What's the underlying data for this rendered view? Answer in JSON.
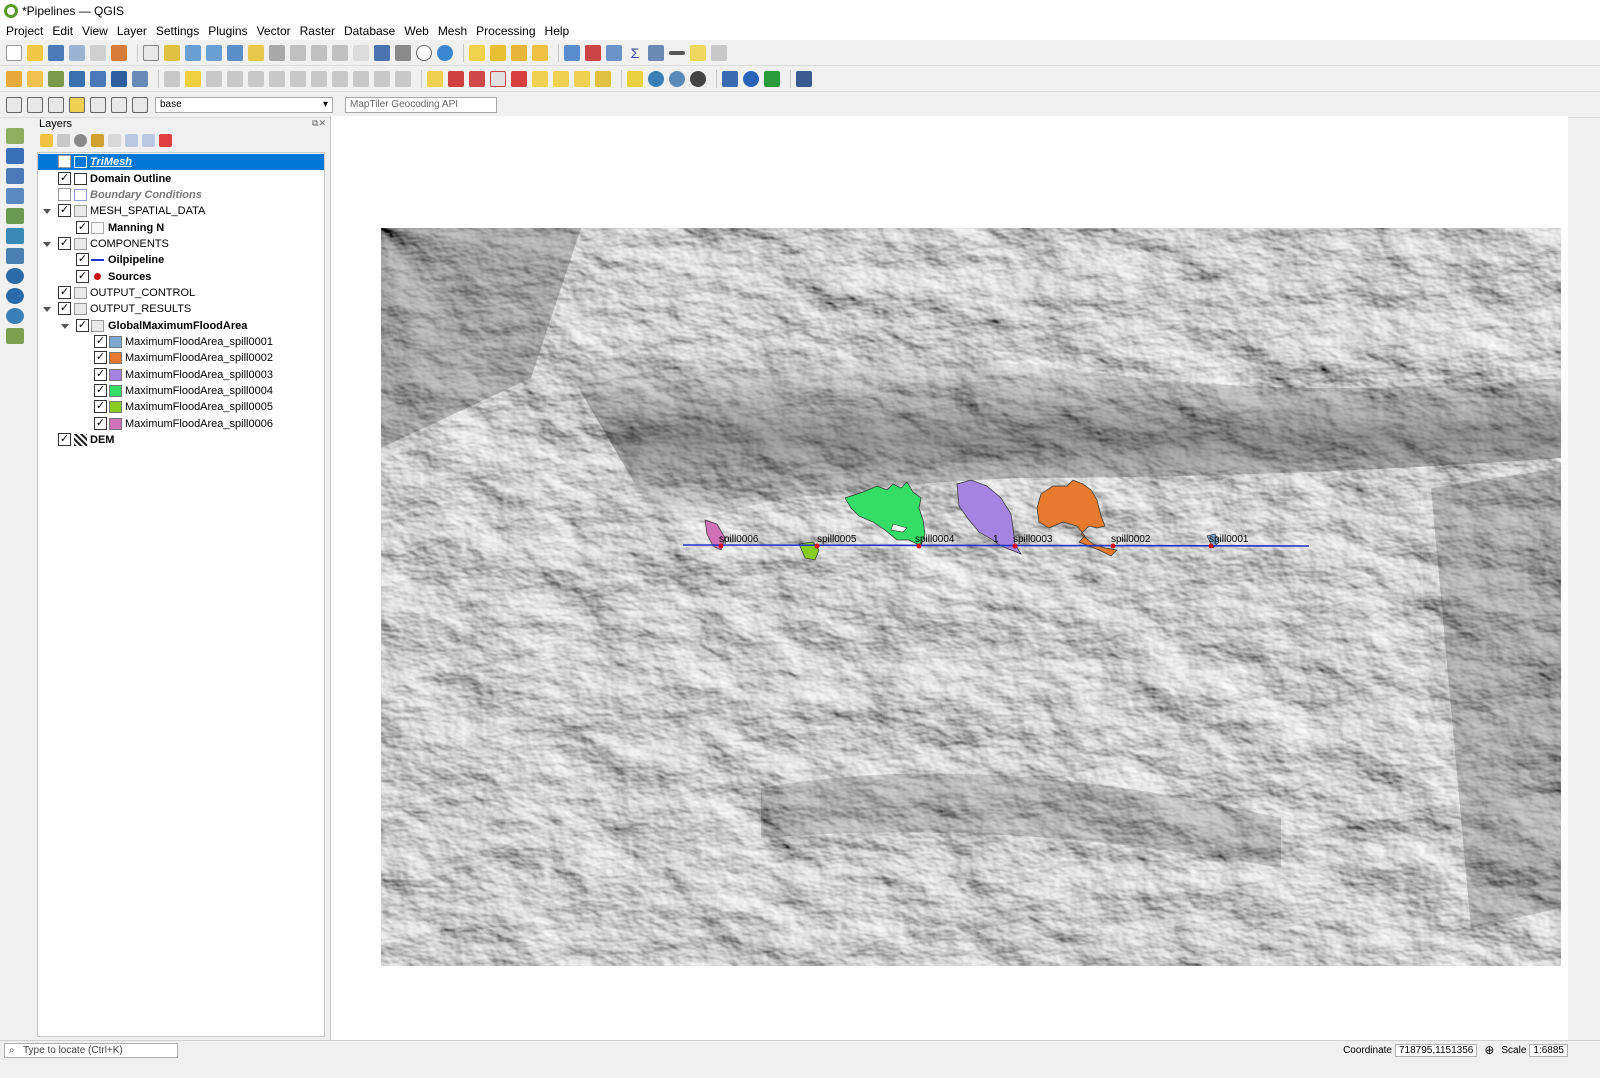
{
  "window": {
    "title": "*Pipelines — QGIS"
  },
  "menu": [
    "Project",
    "Edit",
    "View",
    "Layer",
    "Settings",
    "Plugins",
    "Vector",
    "Raster",
    "Database",
    "Web",
    "Mesh",
    "Processing",
    "Help"
  ],
  "toolbar3": {
    "style_combo": "base",
    "geocoder_placeholder": "MapTiler Geocoding API"
  },
  "layers_panel": {
    "title": "Layers",
    "rows": [
      {
        "label": "TriMesh",
        "checked": false,
        "style": "selected-italic"
      },
      {
        "label": "Domain Outline",
        "checked": true,
        "style": "bold"
      },
      {
        "label": "Boundary Conditions",
        "checked": false,
        "style": "italic-grey"
      },
      {
        "label": "MESH_SPATIAL_DATA",
        "checked": true,
        "style": "group"
      },
      {
        "label": "Manning N",
        "checked": true,
        "style": "bold"
      },
      {
        "label": "COMPONENTS",
        "checked": true,
        "style": "group"
      },
      {
        "label": "Oilpipeline",
        "checked": true,
        "style": "bold"
      },
      {
        "label": "Sources",
        "checked": true,
        "style": "bold"
      },
      {
        "label": "OUTPUT_CONTROL",
        "checked": true,
        "style": "group"
      },
      {
        "label": "OUTPUT_RESULTS",
        "checked": true,
        "style": "group"
      },
      {
        "label": "GlobalMaximumFloodArea",
        "checked": true,
        "style": "bold-group"
      },
      {
        "label": "MaximumFloodArea_spill0001",
        "checked": true,
        "color": "#7fa8d0"
      },
      {
        "label": "MaximumFloodArea_spill0002",
        "checked": true,
        "color": "#e87a30"
      },
      {
        "label": "MaximumFloodArea_spill0003",
        "checked": true,
        "color": "#a484e0"
      },
      {
        "label": "MaximumFloodArea_spill0004",
        "checked": true,
        "color": "#33dd66"
      },
      {
        "label": "MaximumFloodArea_spill0005",
        "checked": true,
        "color": "#88cc22"
      },
      {
        "label": "MaximumFloodArea_spill0006",
        "checked": true,
        "color": "#d070b8"
      },
      {
        "label": "DEM",
        "checked": true,
        "style": "bold"
      }
    ]
  },
  "map": {
    "spill_labels": [
      "spill0006",
      "spill0005",
      "spill0004",
      "1",
      "spill0003",
      "spill0002",
      "spill0001"
    ],
    "pipeline_color": "#2233cc",
    "spill_colors": {
      "spill0001": "#7fa8d0",
      "spill0002": "#e87a30",
      "spill0003": "#a484e0",
      "spill0004": "#33dd66",
      "spill0005": "#88cc22",
      "spill0006": "#d070b8"
    }
  },
  "status": {
    "locate_placeholder": "Type to locate (Ctrl+K)",
    "coordinate_label": "Coordinate",
    "coordinate_value": "718795,1151356",
    "scale_label": "Scale",
    "scale_value": "1:6885"
  }
}
